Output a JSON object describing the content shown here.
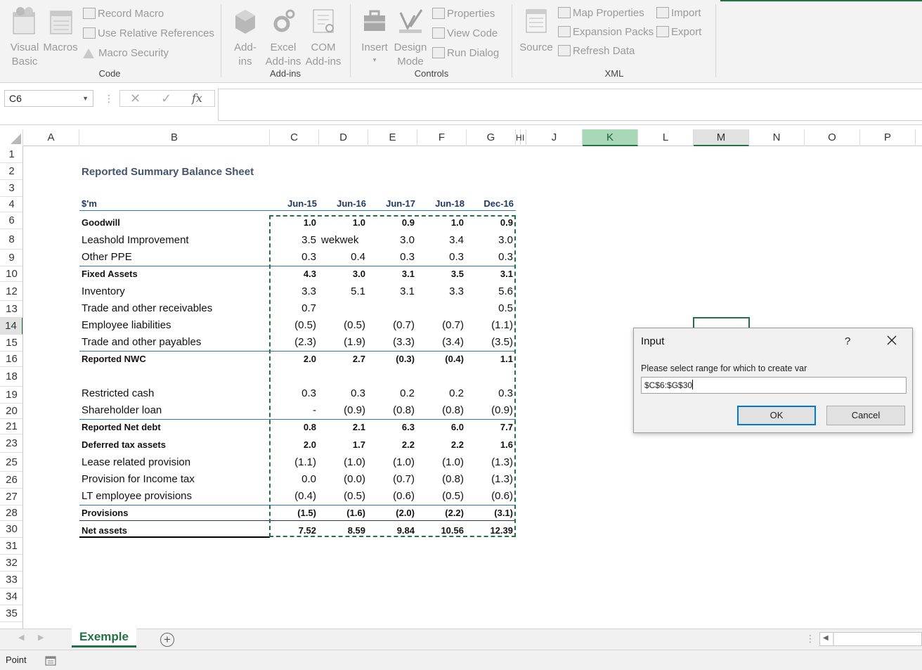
{
  "ribbon": {
    "groups": {
      "code": "Code",
      "addins": "Add-ins",
      "controls": "Controls",
      "xml": "XML"
    },
    "visual_basic": [
      "Visual",
      "Basic"
    ],
    "macros": "Macros",
    "record_macro": "Record Macro",
    "use_relative": "Use Relative References",
    "macro_security": "Macro Security",
    "add_ins": [
      "Add-",
      "ins"
    ],
    "excel_addins": [
      "Excel",
      "Add-ins"
    ],
    "com_addins": [
      "COM",
      "Add-ins"
    ],
    "insert": "Insert",
    "design_mode": [
      "Design",
      "Mode"
    ],
    "properties": "Properties",
    "view_code": "View Code",
    "run_dialog": "Run Dialog",
    "source": "Source",
    "map_properties": "Map Properties",
    "expansion_packs": "Expansion Packs",
    "refresh_data": "Refresh Data",
    "import": "Import",
    "export": "Export"
  },
  "formula_bar": {
    "name_box": "C6",
    "fx": "fx",
    "value": ""
  },
  "columns": [
    "A",
    "B",
    "C",
    "D",
    "E",
    "F",
    "G",
    "H",
    "I",
    "J",
    "K",
    "L",
    "M",
    "N",
    "O",
    "P"
  ],
  "rows": [
    "1",
    "2",
    "3",
    "4",
    "6",
    "8",
    "9",
    "10",
    "12",
    "13",
    "14",
    "15",
    "16",
    "18",
    "19",
    "20",
    "21",
    "23",
    "25",
    "26",
    "27",
    "28",
    "30",
    "31",
    "32",
    "33",
    "34",
    "35"
  ],
  "sheet": {
    "title": "Reported Summary Balance Sheet",
    "unit": "$'m",
    "periods": [
      "Jun-15",
      "Jun-16",
      "Jun-17",
      "Jun-18",
      "Dec-16"
    ],
    "lines": [
      {
        "label": "Goodwill",
        "values": [
          "1.0",
          "1.0",
          "0.9",
          "1.0",
          "0.9"
        ]
      },
      {
        "label": "Leashold Improvement",
        "values": [
          "3.5",
          "wekwek",
          "3.0",
          "3.4",
          "3.0"
        ]
      },
      {
        "label": "Other PPE",
        "values": [
          "0.3",
          "0.4",
          "0.3",
          "0.3",
          "0.3"
        ]
      },
      {
        "label": "Fixed Assets",
        "values": [
          "4.3",
          "3.0",
          "3.1",
          "3.5",
          "3.1"
        ]
      },
      {
        "label": "Inventory",
        "values": [
          "3.3",
          "5.1",
          "3.1",
          "3.3",
          "5.6"
        ]
      },
      {
        "label": "Trade and other receivables",
        "values": [
          "0.7",
          "",
          "",
          "",
          "0.5"
        ]
      },
      {
        "label": "Employee liabilities",
        "values": [
          "(0.5)",
          "(0.5)",
          "(0.7)",
          "(0.7)",
          "(1.1)"
        ]
      },
      {
        "label": "Trade and other payables",
        "values": [
          "(2.3)",
          "(1.9)",
          "(3.3)",
          "(3.4)",
          "(3.5)"
        ]
      },
      {
        "label": "Reported NWC",
        "values": [
          "2.0",
          "2.7",
          "(0.3)",
          "(0.4)",
          "1.1"
        ]
      },
      {
        "label": "Restricted cash",
        "values": [
          "0.3",
          "0.3",
          "0.2",
          "0.2",
          "0.3"
        ]
      },
      {
        "label": "Shareholder loan",
        "values": [
          "-",
          "(0.9)",
          "(0.8)",
          "(0.8)",
          "(0.9)"
        ]
      },
      {
        "label": "Reported Net debt",
        "values": [
          "0.8",
          "2.1",
          "6.3",
          "6.0",
          "7.7"
        ]
      },
      {
        "label": "Deferred tax assets",
        "values": [
          "2.0",
          "1.7",
          "2.2",
          "2.2",
          "1.6"
        ]
      },
      {
        "label": "Lease related provision",
        "values": [
          "(1.1)",
          "(1.0)",
          "(1.0)",
          "(1.0)",
          "(1.3)"
        ]
      },
      {
        "label": "Provision for Income tax",
        "values": [
          "0.0",
          "(0.0)",
          "(0.7)",
          "(0.8)",
          "(1.3)"
        ]
      },
      {
        "label": "LT employee provisions",
        "values": [
          "(0.4)",
          "(0.5)",
          "(0.6)",
          "(0.5)",
          "(0.6)"
        ]
      },
      {
        "label": "Provisions",
        "values": [
          "(1.5)",
          "(1.6)",
          "(2.0)",
          "(2.2)",
          "(3.1)"
        ]
      },
      {
        "label": "Net assets",
        "values": [
          "7.52",
          "8.59",
          "9.84",
          "10.56",
          "12.39"
        ]
      }
    ]
  },
  "tabs": {
    "sheet_name": "Exemple"
  },
  "status": {
    "mode": "Point"
  },
  "dialog": {
    "title": "Input",
    "help": "?",
    "prompt": "Please select range for which to create var",
    "value": "$C$6:$G$30",
    "ok": "OK",
    "cancel": "Cancel"
  }
}
